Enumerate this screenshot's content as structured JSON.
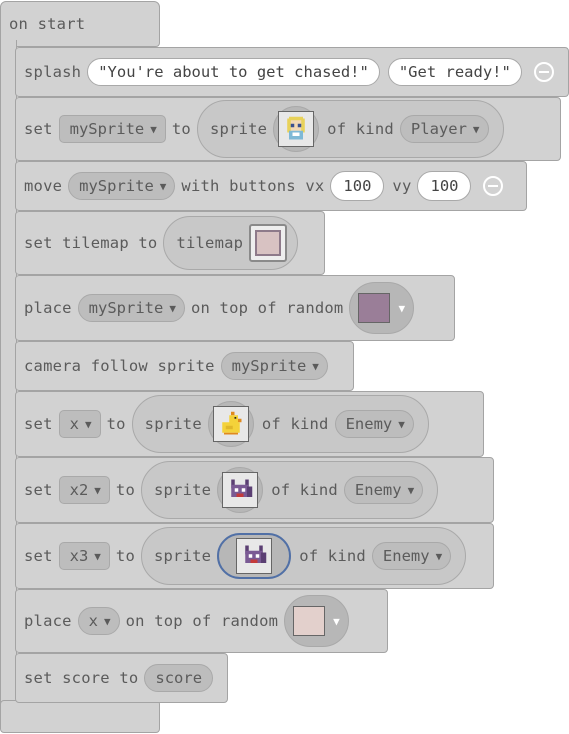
{
  "hat": {
    "label": "on start"
  },
  "splash": {
    "label": "splash",
    "title": "\"You're about to get chased!\"",
    "subtitle": "\"Get ready!\""
  },
  "set_player": {
    "set": "set",
    "variable": "mySprite",
    "to": "to",
    "sprite": "sprite",
    "of_kind": "of kind",
    "kind": "Player"
  },
  "move": {
    "move": "move",
    "variable": "mySprite",
    "with_buttons_vx": "with buttons vx",
    "vx": "100",
    "vy_label": "vy",
    "vy": "100"
  },
  "tilemap": {
    "label": "set tilemap to",
    "inner": "tilemap"
  },
  "place1": {
    "label": "place",
    "variable": "mySprite",
    "on_top": "on top of random"
  },
  "camera": {
    "label": "camera follow sprite",
    "variable": "mySprite"
  },
  "set_x": {
    "set": "set",
    "variable": "x",
    "to": "to",
    "sprite": "sprite",
    "of_kind": "of kind",
    "kind": "Enemy"
  },
  "set_x2": {
    "set": "set",
    "variable": "x2",
    "to": "to",
    "sprite": "sprite",
    "of_kind": "of kind",
    "kind": "Enemy"
  },
  "set_x3": {
    "set": "set",
    "variable": "x3",
    "to": "to",
    "sprite": "sprite",
    "of_kind": "of kind",
    "kind": "Enemy"
  },
  "place2": {
    "label": "place",
    "variable": "x",
    "on_top": "on top of random"
  },
  "score": {
    "label": "set score to",
    "inner": "score"
  },
  "colors": {
    "block": "#d2d2d2",
    "tile_purple": "#9a7e98",
    "tile_pink": "#e3d0cc",
    "tilemap_tile": "#d8c2c2",
    "selected_outline": "#5170a6"
  },
  "icons": {
    "caret": "dropdown-caret",
    "minus": "remove-circle-icon"
  }
}
